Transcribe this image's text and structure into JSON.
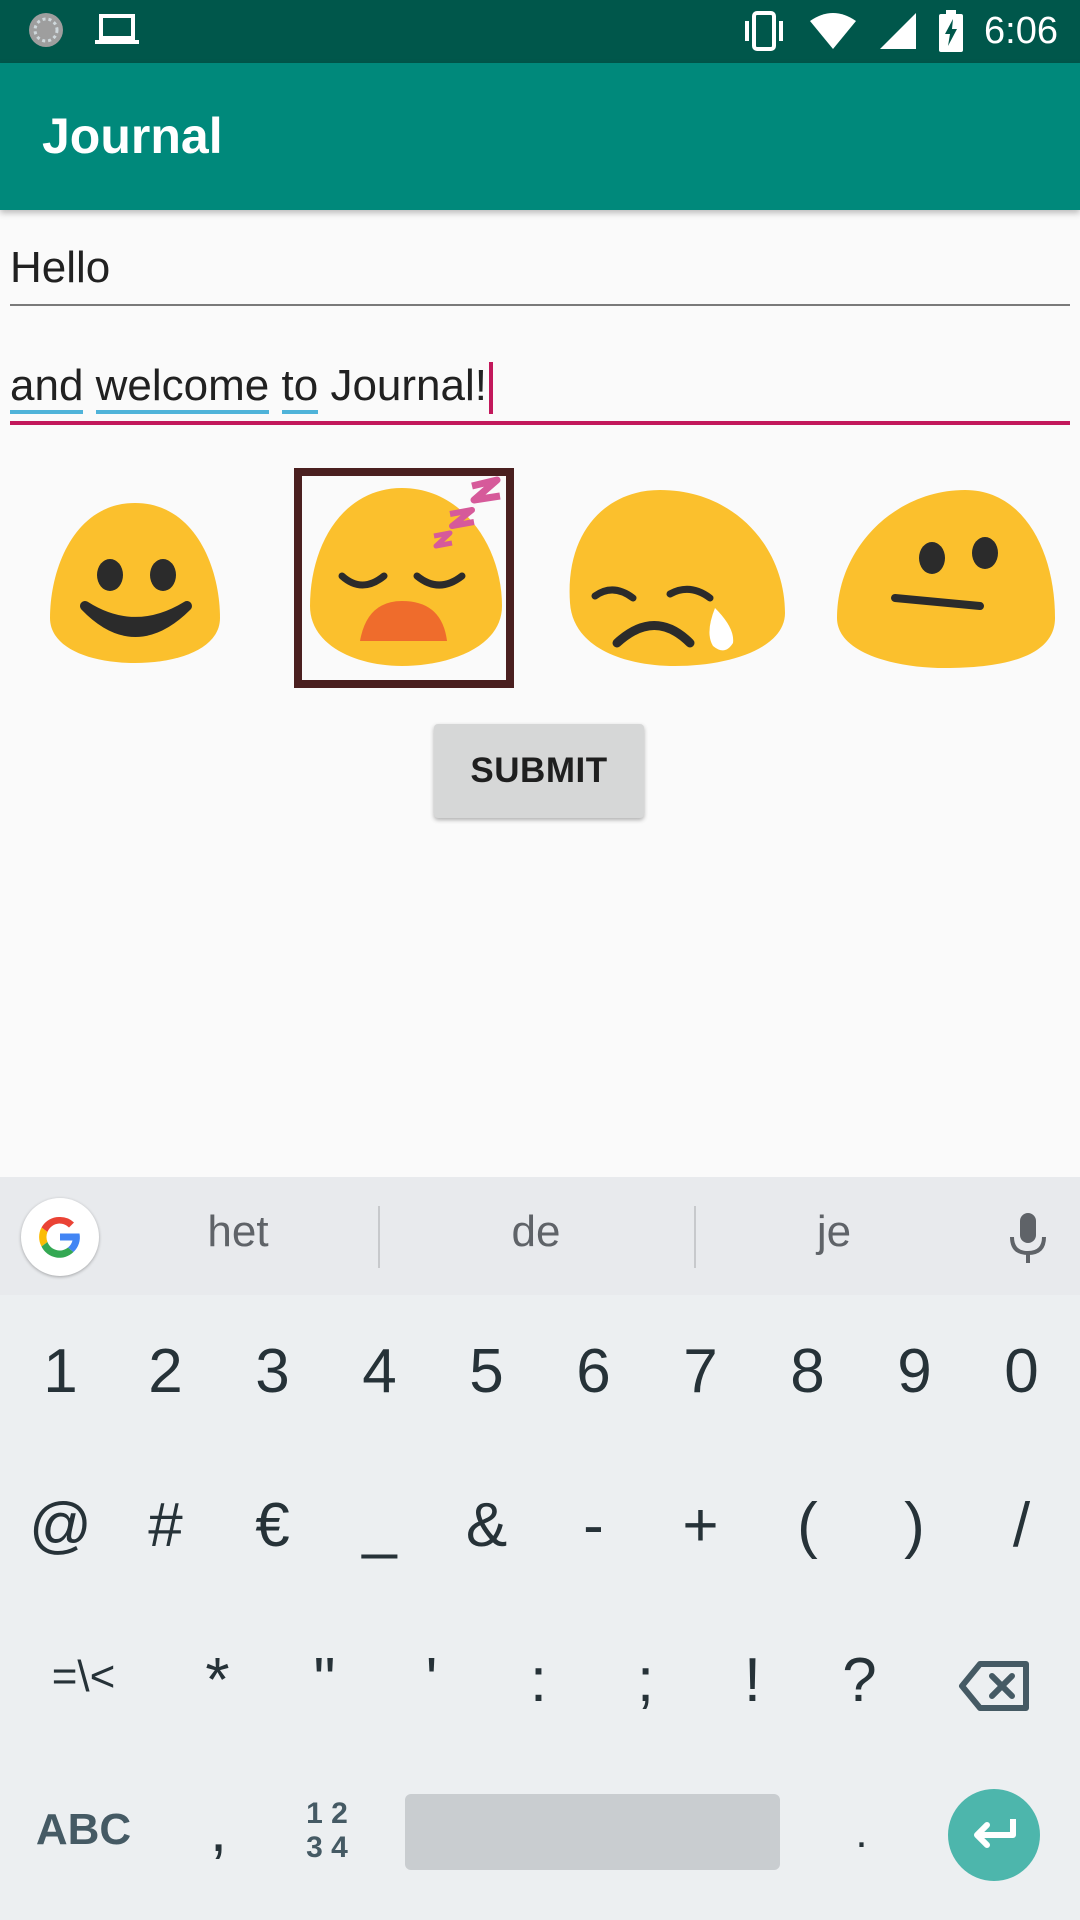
{
  "status_bar": {
    "time": "6:06",
    "icons": [
      "sync-icon",
      "laptop-icon",
      "vibrate-icon",
      "wifi-icon",
      "signal-icon",
      "battery-charging-icon"
    ]
  },
  "app_bar": {
    "title": "Journal"
  },
  "form": {
    "title_value": "Hello",
    "body_words": [
      "and",
      "welcome",
      "to"
    ],
    "body_rest": "Journal!"
  },
  "moods": [
    {
      "name": "smiling-face-icon",
      "selected": false
    },
    {
      "name": "sleeping-face-icon",
      "selected": true
    },
    {
      "name": "crying-face-icon",
      "selected": false
    },
    {
      "name": "confused-face-icon",
      "selected": false
    }
  ],
  "submit_label": "SUBMIT",
  "keyboard": {
    "suggestions": [
      "het",
      "de",
      "je"
    ],
    "row1": [
      "1",
      "2",
      "3",
      "4",
      "5",
      "6",
      "7",
      "8",
      "9",
      "0"
    ],
    "row2": [
      "@",
      "#",
      "€",
      "_",
      "&",
      "-",
      "+",
      "(",
      ")",
      "/"
    ],
    "row3": [
      "=\\<",
      "*",
      "\"",
      "'",
      ":",
      ";",
      "!",
      "?"
    ],
    "abc_label": "ABC",
    "comma": ",",
    "numpad_label_top": "1 2",
    "numpad_label_bottom": "3 4",
    "period": ".",
    "colors": {
      "enter": "#4db6ac",
      "accent": "#c2185b",
      "appbar": "#00897b"
    }
  }
}
